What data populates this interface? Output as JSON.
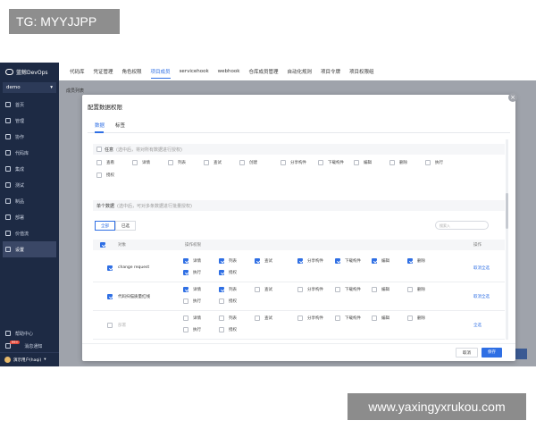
{
  "overlay_tag": "TG: MYYJJPP",
  "watermark": "www.yaxingyxrukou.com",
  "app": {
    "logo_text": "蓝鲸DevOps",
    "project": "demo",
    "sidebar": [
      {
        "label": "首页",
        "icon": "home-icon"
      },
      {
        "label": "管理",
        "icon": "manage-icon"
      },
      {
        "label": "协作",
        "icon": "collab-icon"
      },
      {
        "label": "代码库",
        "icon": "repo-icon"
      },
      {
        "label": "集成",
        "icon": "integration-icon"
      },
      {
        "label": "测试",
        "icon": "test-icon"
      },
      {
        "label": "制品",
        "icon": "artifact-icon"
      },
      {
        "label": "部署",
        "icon": "deploy-icon"
      },
      {
        "label": "价值流",
        "icon": "value-stream-icon"
      },
      {
        "label": "设置",
        "icon": "gear-icon",
        "active": true
      }
    ],
    "help": "帮助中心",
    "notify": "消息通知",
    "notify_badge": "99+",
    "user": "演示用户(haqi)",
    "topnav": [
      "代码库",
      "凭证管理",
      "角色权限",
      "项目成员",
      "servicehook",
      "webhook",
      "仓库成员管理",
      "自动化规则",
      "项目令牌",
      "项目权限组"
    ],
    "topnav_active": 3,
    "content_label": "成员列表"
  },
  "modal": {
    "title": "配置数据权限",
    "tabs": [
      "数据",
      "标签"
    ],
    "any_label": "任意",
    "any_hint": "(选中后，将对所有数据进行授权)",
    "any_perms": [
      "查看",
      "详情",
      "列表",
      "查试",
      "创建",
      "分享构件",
      "下载构件",
      "编辑",
      "删除",
      "执行",
      "授权"
    ],
    "single_label": "单个数据",
    "single_hint": "(选中后，可对多条数据进行批量授权)",
    "filter": [
      "全部",
      "已选"
    ],
    "search_placeholder": "搜索入",
    "col_object": "对象",
    "col_perms": "操作权限",
    "col_action": "操作",
    "rows": [
      {
        "name": "change request",
        "checked": true,
        "perms": [
          [
            "详情",
            true
          ],
          [
            "列表",
            true
          ],
          [
            "查试",
            true
          ],
          [
            "分享构件",
            true
          ],
          [
            "下载构件",
            true
          ],
          [
            "编辑",
            true
          ],
          [
            "删除",
            true
          ],
          [
            "执行",
            true
          ],
          [
            "授权",
            true
          ]
        ],
        "action": "取消全选"
      },
      {
        "name": "代码扫描质量红线",
        "checked": true,
        "perms": [
          [
            "详情",
            true
          ],
          [
            "列表",
            true
          ],
          [
            "查试",
            false
          ],
          [
            "分享构件",
            false
          ],
          [
            "下载构件",
            false
          ],
          [
            "编辑",
            false
          ],
          [
            "删除",
            false
          ],
          [
            "执行",
            false
          ],
          [
            "授权",
            false
          ]
        ],
        "action": "取消全选"
      },
      {
        "name": "部署",
        "checked": false,
        "perms": [
          [
            "详情",
            false
          ],
          [
            "列表",
            false
          ],
          [
            "查试",
            false
          ],
          [
            "分享构件",
            false
          ],
          [
            "下载构件",
            false
          ],
          [
            "编辑",
            false
          ],
          [
            "删除",
            false
          ],
          [
            "执行",
            false
          ],
          [
            "授权",
            false
          ]
        ],
        "action": "全选"
      }
    ],
    "cancel": "取消",
    "save": "保存"
  }
}
